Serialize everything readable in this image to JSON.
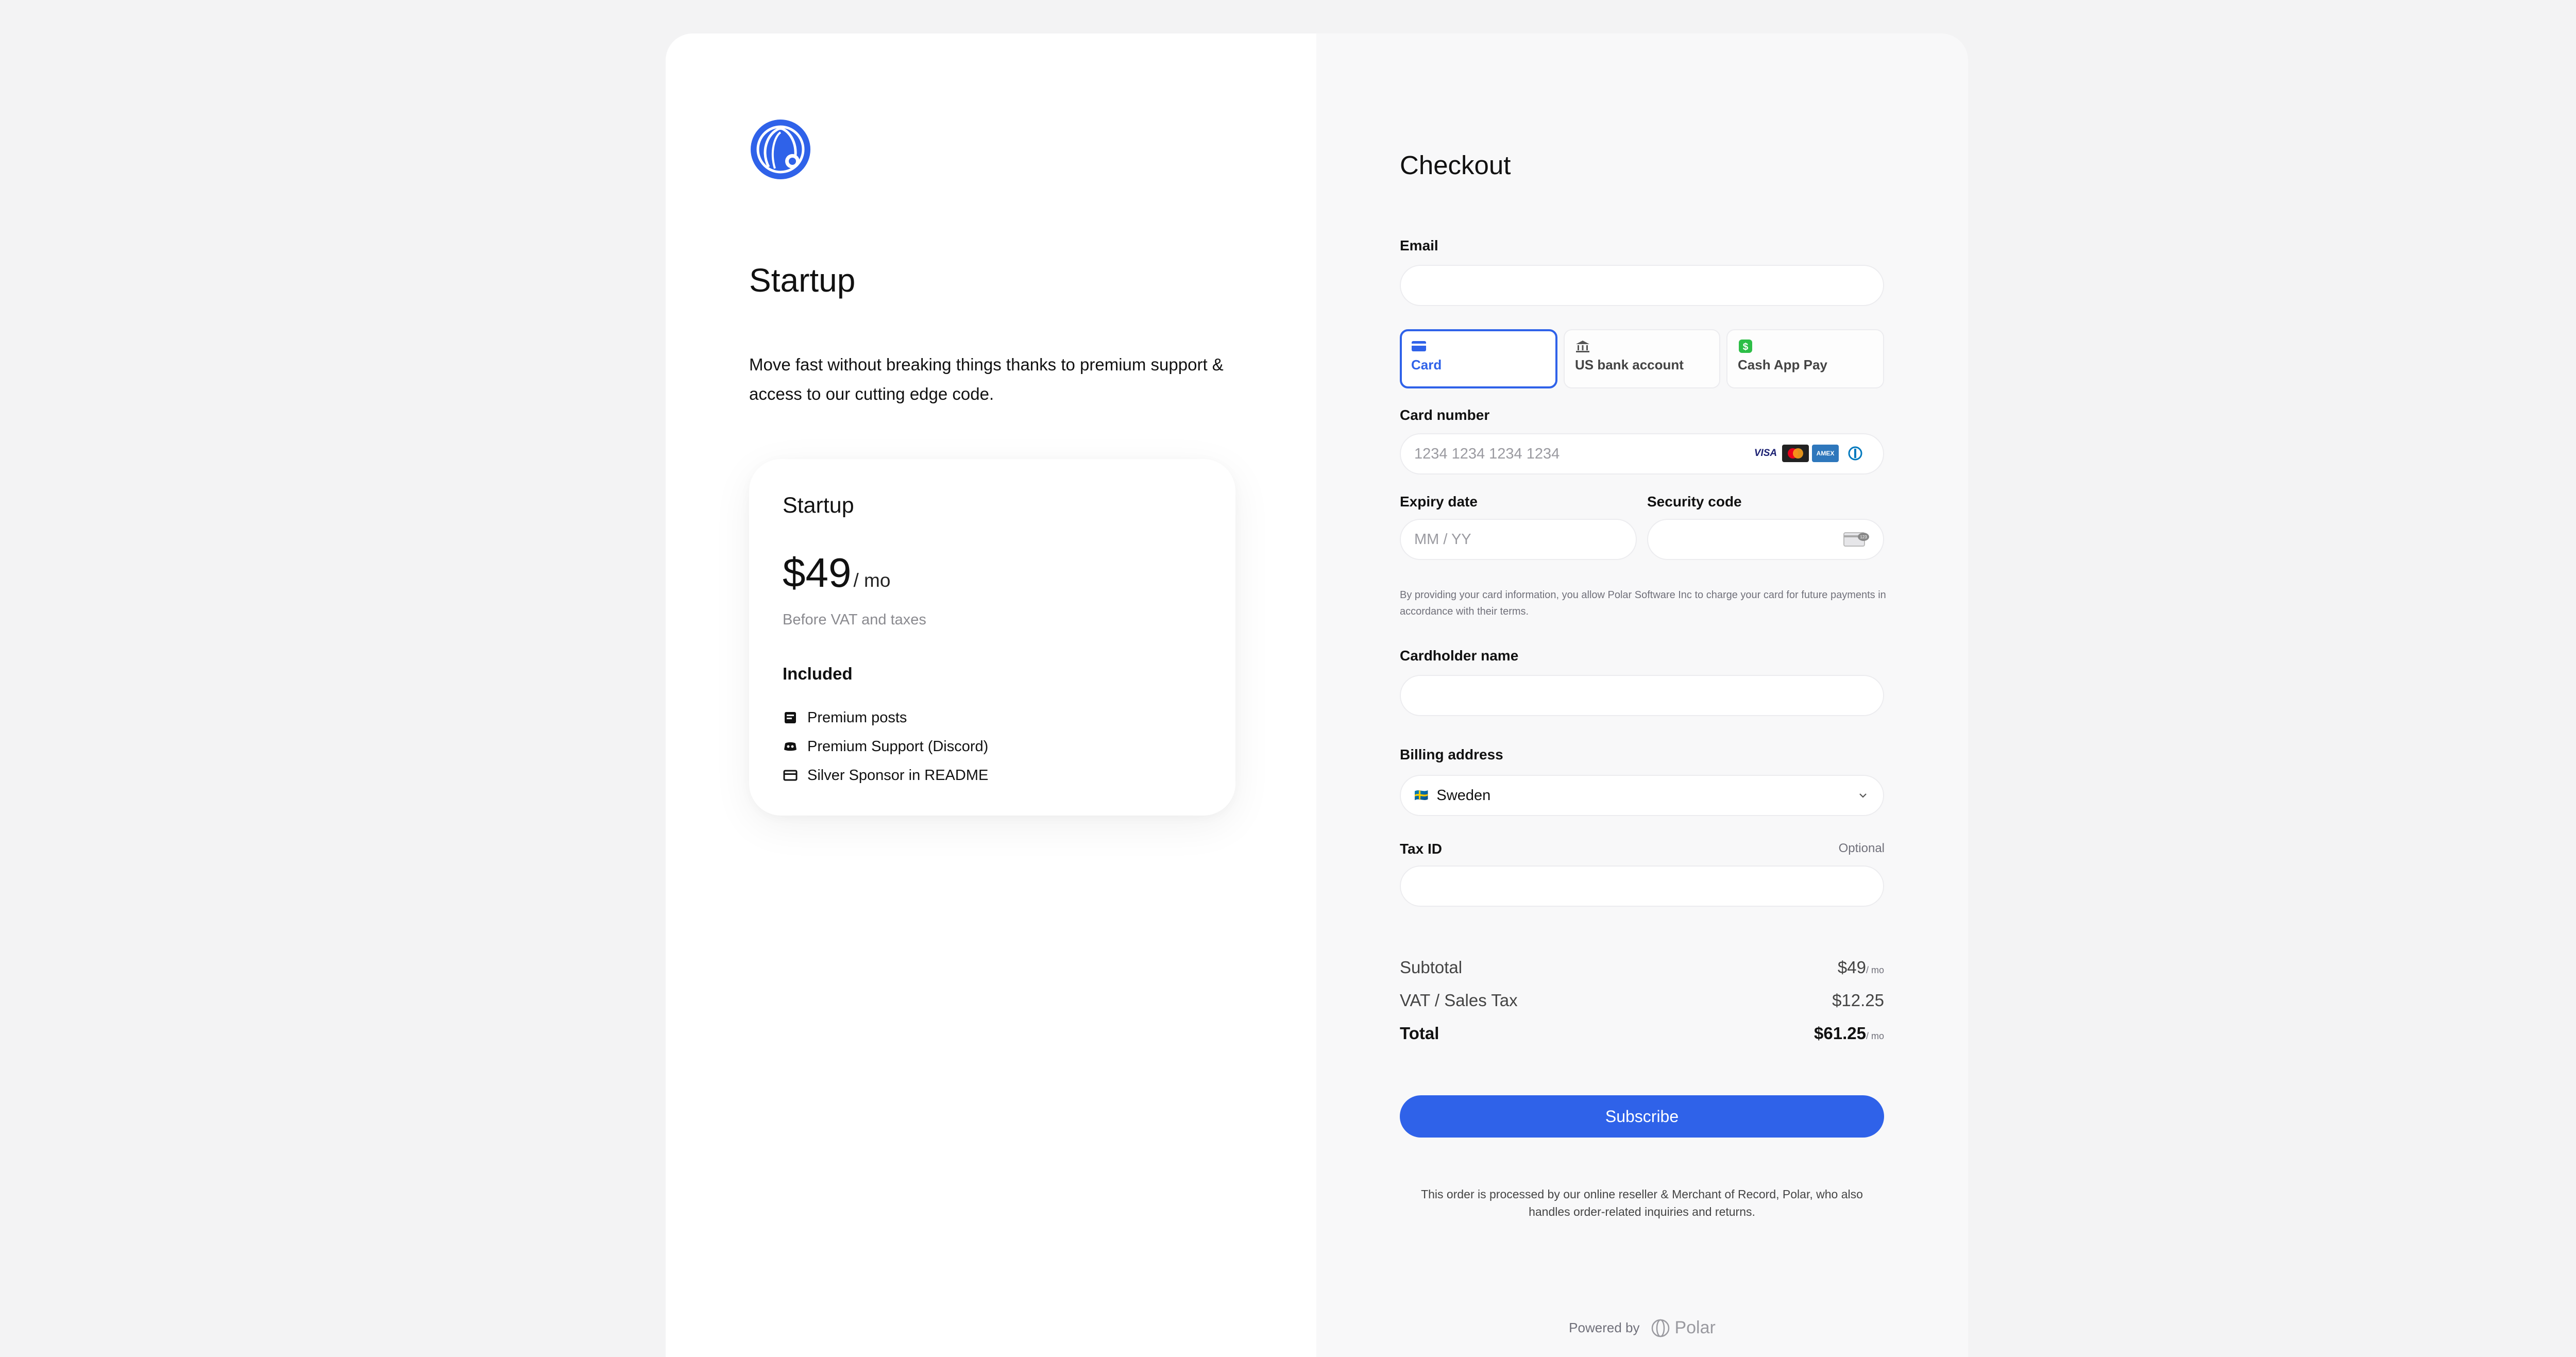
{
  "product": {
    "name": "Startup",
    "description": "Move fast without breaking things thanks to premium support & access to our cutting edge code."
  },
  "plan": {
    "name": "Startup",
    "price": "$49",
    "interval": "/ mo",
    "price_note": "Before VAT and taxes",
    "included_title": "Included",
    "benefits": [
      {
        "label": "Premium posts",
        "icon": "posts-icon"
      },
      {
        "label": "Premium Support (Discord)",
        "icon": "discord-icon"
      },
      {
        "label": "Silver Sponsor in README",
        "icon": "sponsor-icon"
      }
    ]
  },
  "checkout": {
    "title": "Checkout",
    "email_label": "Email",
    "email_value": "",
    "payment_methods": [
      {
        "label": "Card",
        "icon": "card-icon",
        "active": true
      },
      {
        "label": "US bank account",
        "icon": "bank-icon",
        "active": false
      },
      {
        "label": "Cash App Pay",
        "icon": "cash-app-icon",
        "active": false
      }
    ],
    "card_number_label": "Card number",
    "card_number_placeholder": "1234 1234 1234 1234",
    "card_brands": [
      "VISA",
      "mastercard",
      "amex",
      "diners"
    ],
    "expiry_label": "Expiry date",
    "expiry_placeholder": "MM / YY",
    "security_label": "Security code",
    "consent_text": "By providing your card information, you allow Polar Software Inc to charge your card for future payments in accordance with their terms.",
    "cardholder_label": "Cardholder name",
    "billing_label": "Billing address",
    "country": "Sweden",
    "country_flag": "🇸🇪",
    "tax_id_label": "Tax ID",
    "tax_id_optional": "Optional"
  },
  "summary": {
    "subtotal_label": "Subtotal",
    "subtotal_value": "$49",
    "vat_label": "VAT / Sales Tax",
    "vat_value": "$12.25",
    "total_label": "Total",
    "total_value": "$61.25",
    "per": "/ mo"
  },
  "subscribe_label": "Subscribe",
  "merchant_note": "This order is processed by our online reseller & Merchant of Record, Polar, who also handles order-related inquiries and returns.",
  "powered_by": "Powered by",
  "brand": "Polar",
  "colors": {
    "accent": "#2f62e9",
    "background": "#f3f3f4"
  }
}
